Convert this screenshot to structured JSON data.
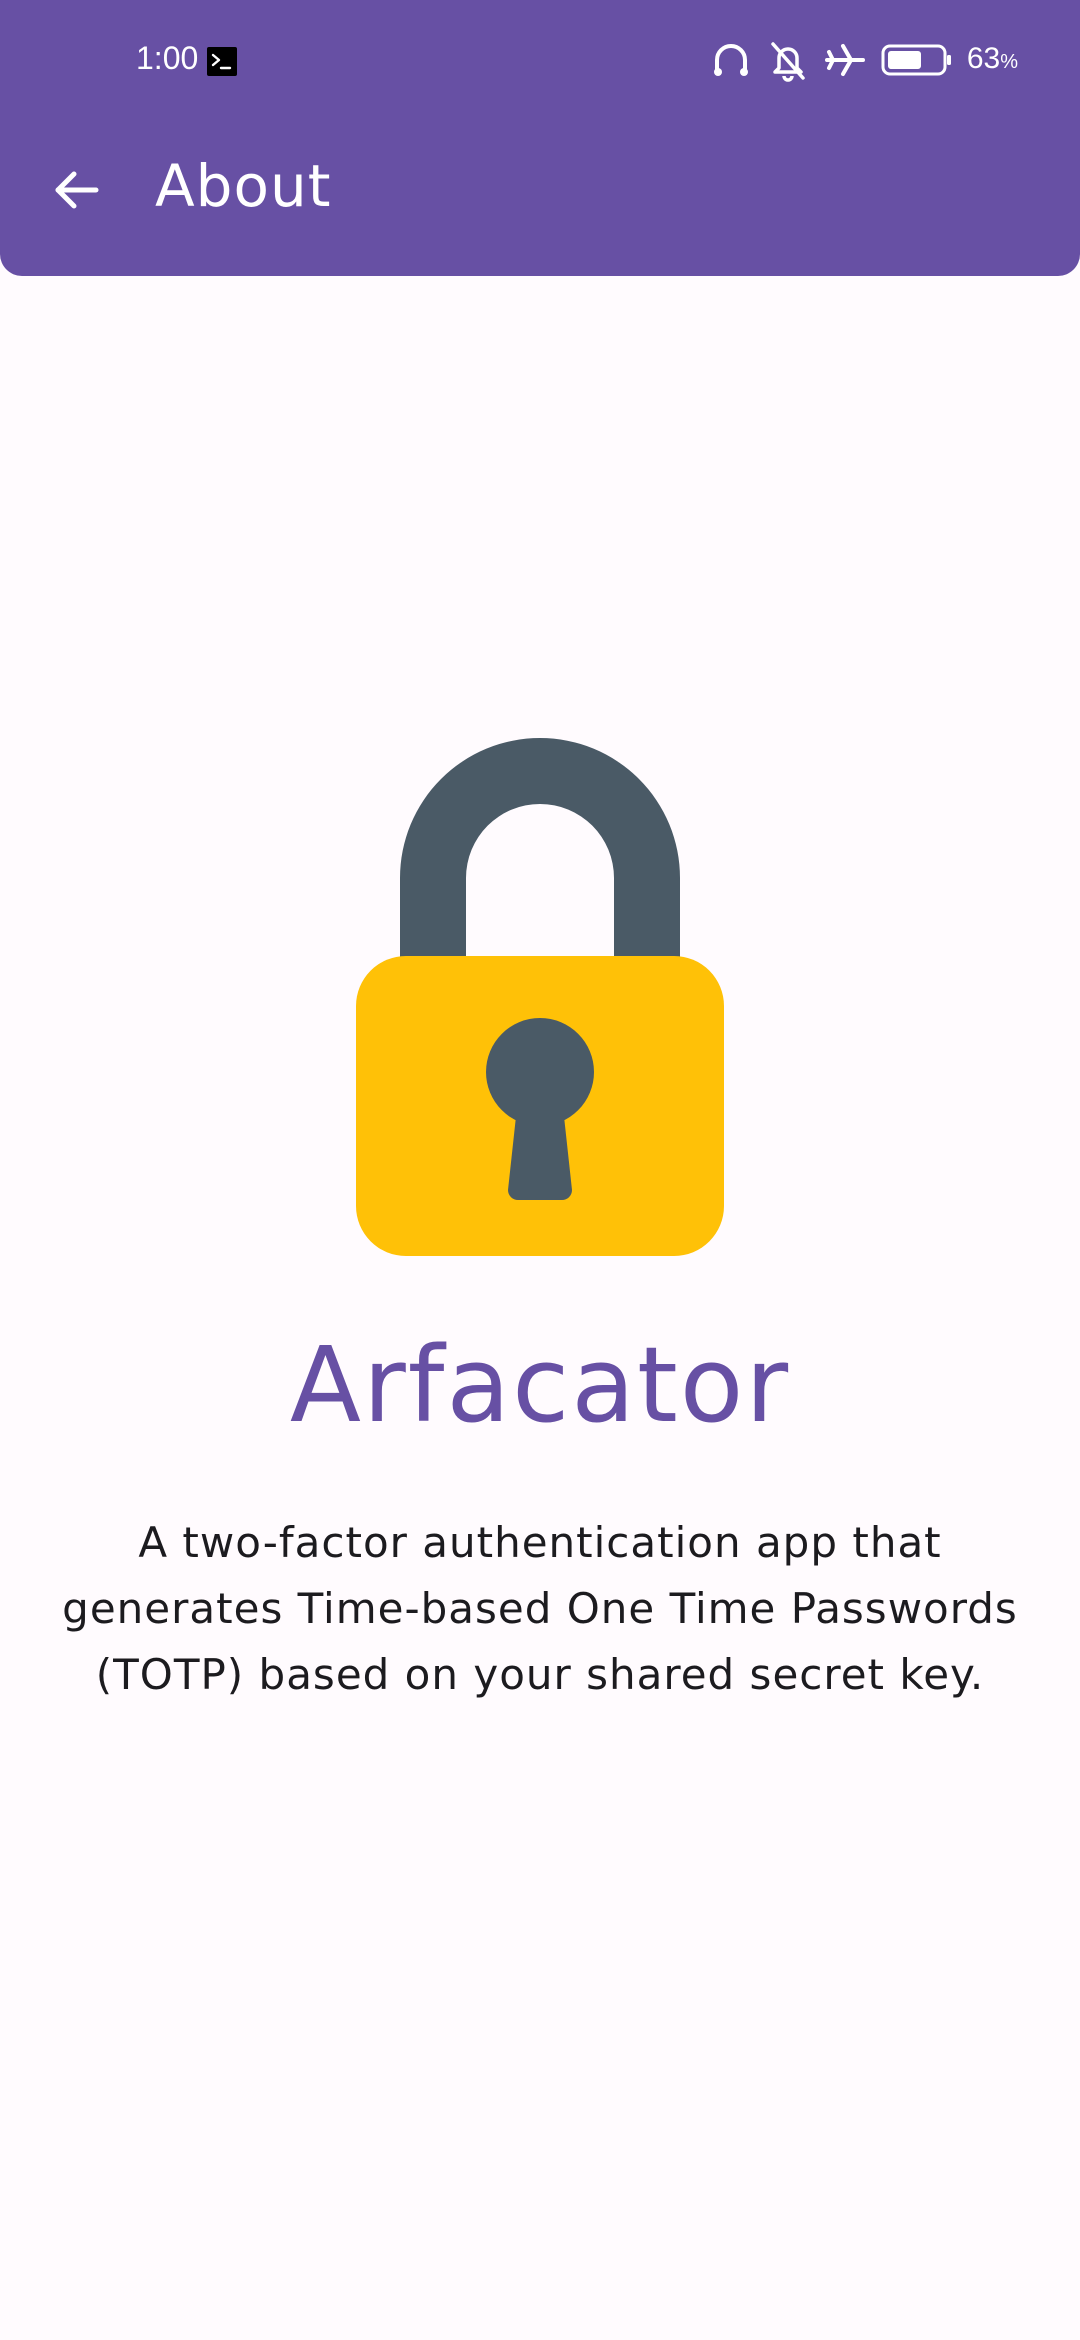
{
  "status_bar": {
    "time": "1:00",
    "battery_percent": "63",
    "battery_unit": "%",
    "battery_level": 0.63,
    "icons": [
      "terminal-icon",
      "headphones-icon",
      "bell-off-icon",
      "airplane-icon",
      "battery-icon"
    ]
  },
  "app_bar": {
    "title": "About",
    "back_icon": "arrow-back-icon"
  },
  "content": {
    "illustration": "padlock-icon",
    "app_name": "Arfacator",
    "description": "A two-factor authentication app that generates Time-based One Time Passwords (TOTP) based on your shared secret key."
  },
  "colors": {
    "primary": "#6750a4",
    "background": "#fffbfe",
    "lock_body": "#ffc107",
    "lock_shackle": "#4a5a66",
    "text": "#1c1b1f"
  }
}
